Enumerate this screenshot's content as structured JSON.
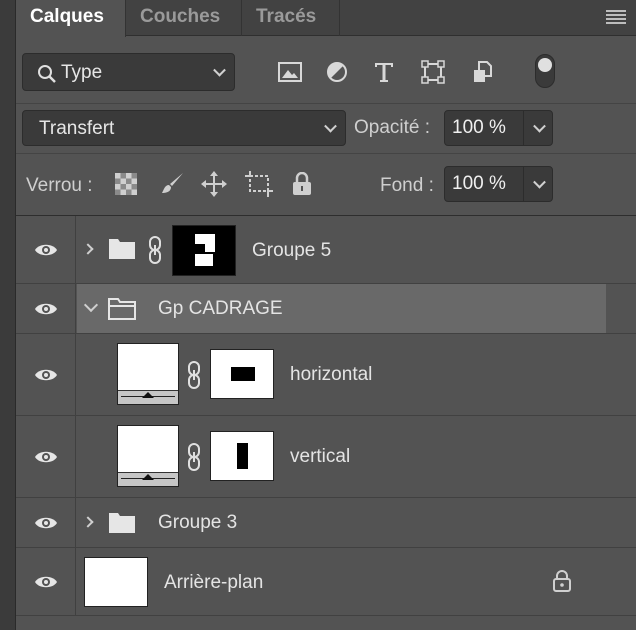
{
  "tabs": [
    {
      "label": "Calques",
      "active": true
    },
    {
      "label": "Couches",
      "active": false
    },
    {
      "label": "Tracés",
      "active": false
    }
  ],
  "panel_menu_icon": "hamburger-menu-icon",
  "filter": {
    "kind_label": "Type",
    "icons": [
      "image-filter-icon",
      "adjustment-filter-icon",
      "type-filter-icon",
      "shape-filter-icon",
      "smart-object-filter-icon"
    ],
    "toggle_state": "on"
  },
  "blend": {
    "mode": "Transfert",
    "opacity_label": "Opacité :",
    "opacity_value": "100 %"
  },
  "locks": {
    "label": "Verrou :",
    "icons": [
      "lock-transparency-icon",
      "lock-pixels-icon",
      "lock-position-icon",
      "lock-artboard-icon",
      "lock-all-icon"
    ],
    "fill_label": "Fond :",
    "fill_value": "100 %"
  },
  "layers": [
    {
      "name": "Groupe 5",
      "type": "group",
      "expanded": false,
      "has_mask": true,
      "visible": true
    },
    {
      "name": "Gp CADRAGE",
      "type": "group",
      "expanded": true,
      "selected": true,
      "visible": true
    },
    {
      "name": "horizontal",
      "type": "adjustment",
      "has_mask": true,
      "visible": true
    },
    {
      "name": "vertical",
      "type": "adjustment",
      "has_mask": true,
      "visible": true
    },
    {
      "name": "Groupe 3",
      "type": "group",
      "expanded": false,
      "visible": true
    },
    {
      "name": "Arrière-plan",
      "type": "background",
      "locked": true,
      "visible": true
    }
  ],
  "colors": {
    "panel_bg": "#535353",
    "selected_row": "#696969",
    "tab_bar": "#424242",
    "field_bg": "#3a3a3a"
  }
}
